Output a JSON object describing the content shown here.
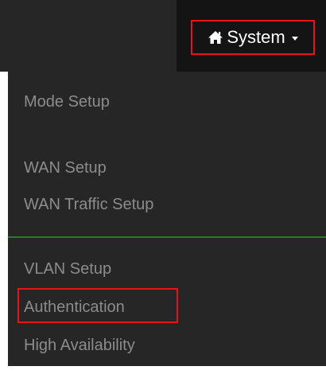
{
  "header": {
    "system_menu": {
      "icon": "home-icon",
      "label": "System",
      "highlight_color": "#e8141c"
    }
  },
  "dropdown": {
    "items": [
      {
        "label": "Mode Setup"
      },
      {
        "label": "WAN Setup"
      },
      {
        "label": "WAN Traffic Setup"
      },
      {
        "label": "VLAN Setup"
      },
      {
        "label": "Authentication",
        "highlighted": true
      },
      {
        "label": "High Availability"
      }
    ],
    "divider_color": "#2a7a2a"
  }
}
